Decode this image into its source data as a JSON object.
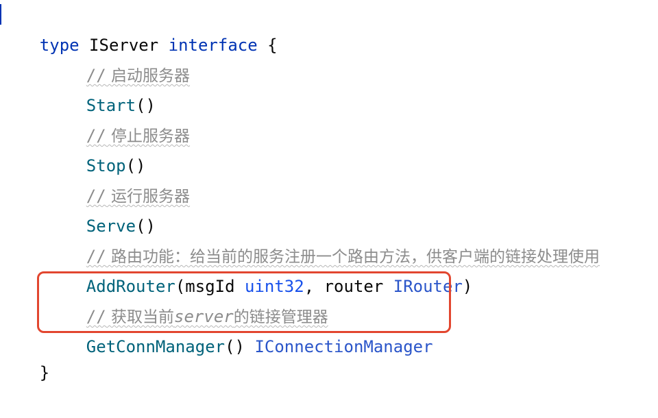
{
  "code": {
    "line1": {
      "kw_type": "type",
      "name": " IServer ",
      "kw_interface": "interface",
      "brace": " {"
    },
    "line2": {
      "slashes": "//",
      "text": " 启动服务器"
    },
    "line3": {
      "fn": "Start",
      "parens": "()"
    },
    "line4": {
      "slashes": "//",
      "text": " 停止服务器"
    },
    "line5": {
      "fn": "Stop",
      "parens": "()"
    },
    "line6": {
      "slashes": "//",
      "text": " 运行服务器"
    },
    "line7": {
      "fn": "Serve",
      "parens": "()"
    },
    "line8": {
      "slashes": "//",
      "text": " 路由功能：给当前的服务注册一个路由方法，供客户端的链接处理使用"
    },
    "line9": {
      "fn": "AddRouter",
      "open": "(msgId ",
      "t1": "uint32",
      "mid": ", router ",
      "t2": "IRouter",
      "close": ")"
    },
    "line10": {
      "slashes": "//",
      "text_pre": " 获取当前",
      "text_ital": "server",
      "text_post": "的链接管理器"
    },
    "line11": {
      "fn": "GetConnManager",
      "parens": "() ",
      "ret": "IConnectionManager"
    },
    "line12": {
      "brace": "}"
    }
  },
  "colors": {
    "keyword": "#0033b3",
    "function": "#00627a",
    "type": "#1750eb",
    "comment": "#8c8c8c",
    "highlight": "#e2462f"
  }
}
